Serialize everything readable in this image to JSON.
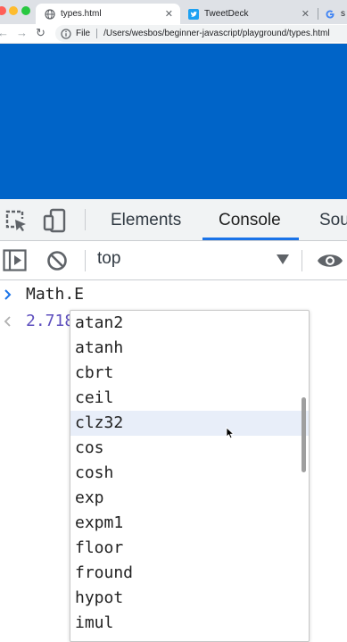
{
  "browser": {
    "tabs": [
      {
        "title": "types.html",
        "active": true,
        "favicon": "globe-icon"
      },
      {
        "title": "TweetDeck",
        "active": false,
        "favicon": "twitter-icon"
      },
      {
        "title": "s",
        "active": false,
        "favicon": "google-icon"
      }
    ],
    "omnibox": {
      "scheme_label": "File",
      "url": "/Users/wesbos/beginner-javascript/playground/types.html"
    }
  },
  "page": {
    "background_color": "#0064c8"
  },
  "devtools": {
    "tabs": [
      "Elements",
      "Console",
      "Sou"
    ],
    "selected_tab": "Console",
    "context": "top",
    "console": {
      "input": "Math.E",
      "result": "2.718"
    },
    "autocomplete": {
      "items": [
        "atan2",
        "atanh",
        "cbrt",
        "ceil",
        "clz32",
        "cos",
        "cosh",
        "exp",
        "expm1",
        "floor",
        "fround",
        "hypot",
        "imul"
      ],
      "selected": "clz32"
    }
  }
}
